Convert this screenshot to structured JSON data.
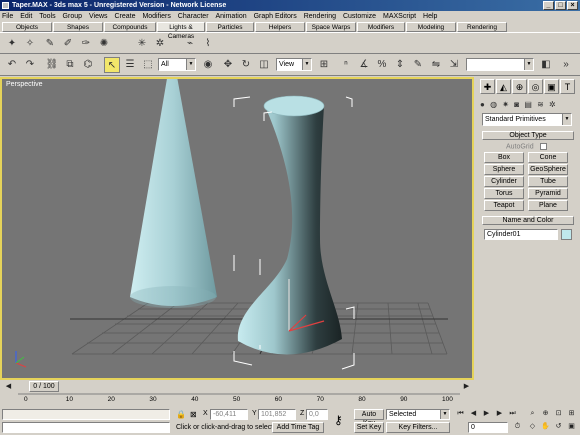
{
  "window": {
    "title": "Taper.MAX - 3ds max 5 - Unregistered Version - Network License"
  },
  "menu": [
    "File",
    "Edit",
    "Tools",
    "Group",
    "Views",
    "Create",
    "Modifiers",
    "Character",
    "Animation",
    "Graph Editors",
    "Rendering",
    "Customize",
    "MAXScript",
    "Help"
  ],
  "tabs": [
    "Objects",
    "Shapes",
    "Compounds",
    "Lights & Cameras",
    "Particles",
    "Helpers",
    "Space Warps",
    "Modifiers",
    "Modeling",
    "Rendering"
  ],
  "toolbar": {
    "selection_filter": "All",
    "ref_coord": "View",
    "named_selection": ""
  },
  "viewport": {
    "label": "Perspective"
  },
  "command_panel": {
    "category": "Standard Primitives",
    "object_type_title": "Object Type",
    "autogrid": "AutoGrid",
    "buttons": [
      "Box",
      "Cone",
      "Sphere",
      "GeoSphere",
      "Cylinder",
      "Tube",
      "Torus",
      "Pyramid",
      "Teapot",
      "Plane"
    ],
    "name_color_title": "Name and Color",
    "object_name": "Cylinder01",
    "object_color": "#bfe8ec"
  },
  "timeline": {
    "frame": "0 / 100"
  },
  "trackbar": {
    "ticks": [
      "0",
      "10",
      "20",
      "30",
      "40",
      "50",
      "60",
      "70",
      "80",
      "90",
      "100"
    ]
  },
  "status": {
    "x_label": "X",
    "x_value": "-60,411",
    "y_label": "Y",
    "y_value": "101,852",
    "z_label": "Z",
    "z_value": "0,0",
    "prompt": "Click or click-and-drag to select obj",
    "add_time_tag": "Add Time Tag",
    "auto_key": "Auto Key",
    "set_key": "Set Key",
    "key_mode": "Selected",
    "key_filters": "Key Filters...",
    "current_frame": "0"
  },
  "colors": {
    "viewport_border": "#e5d35a",
    "title_bar": "#0a246a",
    "object_fill": "#a9d3d8",
    "grid": "#5a5a5a"
  }
}
